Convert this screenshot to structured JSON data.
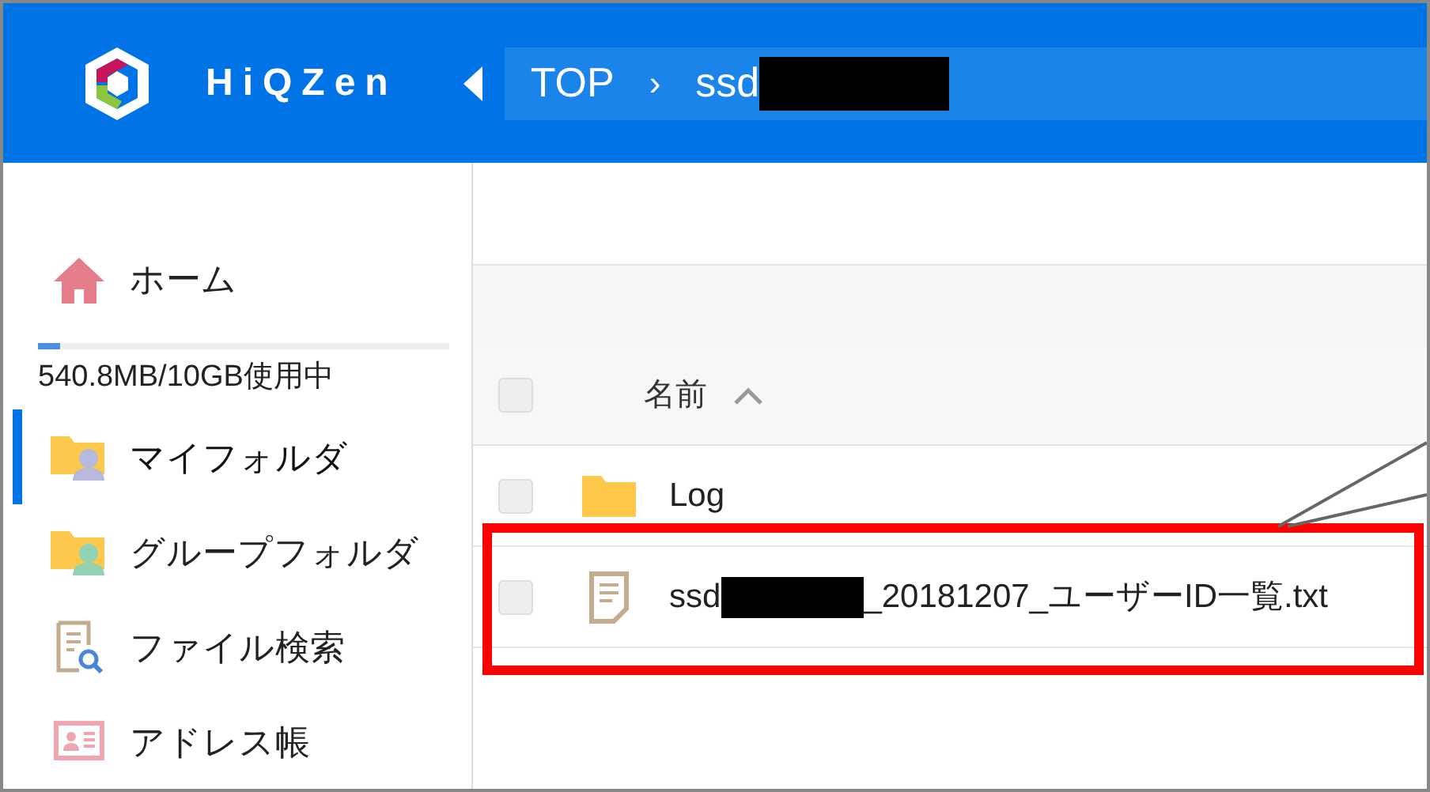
{
  "header": {
    "logo_text": "HiQZen",
    "breadcrumb": [
      {
        "label": "TOP",
        "redacted": false
      },
      {
        "separator": "›",
        "label": "ssd",
        "redacted": true
      }
    ]
  },
  "sidebar": {
    "items": [
      {
        "kind": "link",
        "label": "ホーム",
        "selected": false
      },
      {
        "kind": "storage",
        "label": "540.8MB/10GB使用中",
        "level": 0.053
      },
      {
        "kind": "link",
        "label": "マイフォルダ",
        "selected": true
      },
      {
        "kind": "link",
        "label": "グループフォルダ",
        "selected": false
      },
      {
        "kind": "link",
        "label": "ファイル検索",
        "selected": false
      },
      {
        "kind": "link",
        "label": "アドレス帳",
        "selected": false
      }
    ]
  },
  "table": {
    "select_all_checked": false,
    "columns": [
      {
        "label": "名前",
        "sorted_ascending": true
      }
    ],
    "rows": [
      {
        "kind": "folder",
        "name": "Log",
        "checked": false,
        "highlighted": false,
        "redacted": false
      },
      {
        "kind": "file",
        "name": "ssd",
        "redacted": true,
        "name_end": "_20181207_ユーザーID一覧.txt",
        "checked": false,
        "highlighted": true
      }
    ]
  }
}
